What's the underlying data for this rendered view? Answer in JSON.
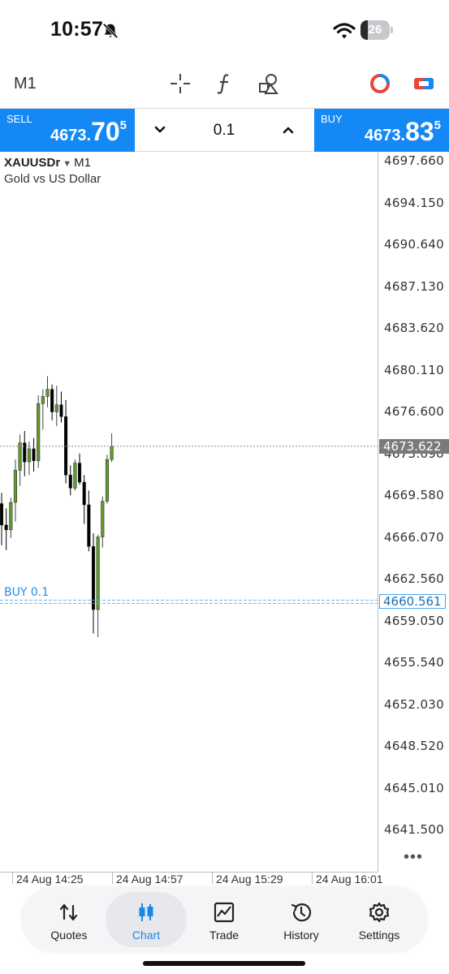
{
  "status_bar": {
    "time": "10:57",
    "battery_level": "26"
  },
  "toolbar": {
    "timeframe": "M1",
    "icons": [
      "crosshair-icon",
      "indicator-function-icon",
      "objects-icon",
      "color-chart-icon",
      "trade-toggle-icon"
    ]
  },
  "trade": {
    "sell_label": "SELL",
    "sell_price_main": "4673.",
    "sell_price_big": "70",
    "sell_price_sup": "5",
    "buy_label": "BUY",
    "buy_price_main": "4673.",
    "buy_price_big": "83",
    "buy_price_sup": "5",
    "volume": "0.1",
    "accent_color": "#1488f5"
  },
  "chart": {
    "symbol": "XAUUSDr",
    "timeframe": "M1",
    "description": "Gold vs US Dollar",
    "current_price": "4673.622",
    "order_label": "BUY 0.1",
    "order_price": "4660.561",
    "price_levels": [
      "4697.660",
      "4694.150",
      "4690.640",
      "4687.130",
      "4683.620",
      "4680.110",
      "4676.600",
      "4673.090",
      "4669.580",
      "4666.070",
      "4662.560",
      "4659.050",
      "4655.540",
      "4652.030",
      "4648.520",
      "4645.010",
      "4641.500"
    ],
    "time_labels": [
      "24 Aug 14:25",
      "24 Aug 14:57",
      "24 Aug 15:29",
      "24 Aug 16:01"
    ],
    "bull_color": "#5f9b2f",
    "bear_color": "#000000"
  },
  "chart_data": {
    "type": "candlestick",
    "title": "",
    "xlabel": "",
    "ylabel": "",
    "ylim": [
      4641.5,
      4697.66
    ],
    "grid": false,
    "candles": [
      {
        "o": 4668.8,
        "h": 4669.7,
        "l": 4665.3,
        "c": 4667.0
      },
      {
        "o": 4667.0,
        "h": 4668.4,
        "l": 4664.9,
        "c": 4666.6
      },
      {
        "o": 4666.6,
        "h": 4669.3,
        "l": 4665.9,
        "c": 4668.9
      },
      {
        "o": 4668.9,
        "h": 4672.5,
        "l": 4667.3,
        "c": 4671.6
      },
      {
        "o": 4671.6,
        "h": 4674.6,
        "l": 4670.3,
        "c": 4673.9
      },
      {
        "o": 4673.9,
        "h": 4674.9,
        "l": 4671.1,
        "c": 4672.3
      },
      {
        "o": 4672.3,
        "h": 4674.0,
        "l": 4671.2,
        "c": 4673.4
      },
      {
        "o": 4673.4,
        "h": 4674.3,
        "l": 4671.5,
        "c": 4672.4
      },
      {
        "o": 4672.4,
        "h": 4677.9,
        "l": 4671.8,
        "c": 4677.2
      },
      {
        "o": 4677.2,
        "h": 4678.4,
        "l": 4675.0,
        "c": 4677.8
      },
      {
        "o": 4677.8,
        "h": 4679.5,
        "l": 4676.9,
        "c": 4678.4
      },
      {
        "o": 4678.4,
        "h": 4678.8,
        "l": 4675.8,
        "c": 4676.5
      },
      {
        "o": 4676.5,
        "h": 4678.7,
        "l": 4675.3,
        "c": 4677.1
      },
      {
        "o": 4677.1,
        "h": 4678.2,
        "l": 4675.6,
        "c": 4676.1
      },
      {
        "o": 4676.1,
        "h": 4677.5,
        "l": 4670.5,
        "c": 4671.2
      },
      {
        "o": 4671.2,
        "h": 4672.0,
        "l": 4669.5,
        "c": 4670.1
      },
      {
        "o": 4670.1,
        "h": 4672.5,
        "l": 4669.9,
        "c": 4672.2
      },
      {
        "o": 4672.2,
        "h": 4673.0,
        "l": 4670.4,
        "c": 4670.6
      },
      {
        "o": 4670.6,
        "h": 4671.2,
        "l": 4667.1,
        "c": 4668.7
      },
      {
        "o": 4668.7,
        "h": 4669.9,
        "l": 4664.8,
        "c": 4665.2
      },
      {
        "o": 4665.2,
        "h": 4666.3,
        "l": 4657.9,
        "c": 4659.9
      },
      {
        "o": 4659.9,
        "h": 4666.2,
        "l": 4657.6,
        "c": 4666.0
      },
      {
        "o": 4666.0,
        "h": 4669.4,
        "l": 4665.1,
        "c": 4669.0
      },
      {
        "o": 4669.0,
        "h": 4672.9,
        "l": 4668.8,
        "c": 4672.5
      },
      {
        "o": 4672.5,
        "h": 4674.7,
        "l": 4672.3,
        "c": 4673.6
      }
    ],
    "current_price": 4673.622,
    "order_line": {
      "label": "BUY 0.1",
      "price": 4660.561
    }
  },
  "bottom_nav": {
    "items": [
      {
        "label": "Quotes",
        "icon": "quotes-icon"
      },
      {
        "label": "Chart",
        "icon": "chart-candles-icon"
      },
      {
        "label": "Trade",
        "icon": "trade-icon"
      },
      {
        "label": "History",
        "icon": "history-icon"
      },
      {
        "label": "Settings",
        "icon": "settings-icon"
      }
    ],
    "active_color": "#1a86e8"
  }
}
